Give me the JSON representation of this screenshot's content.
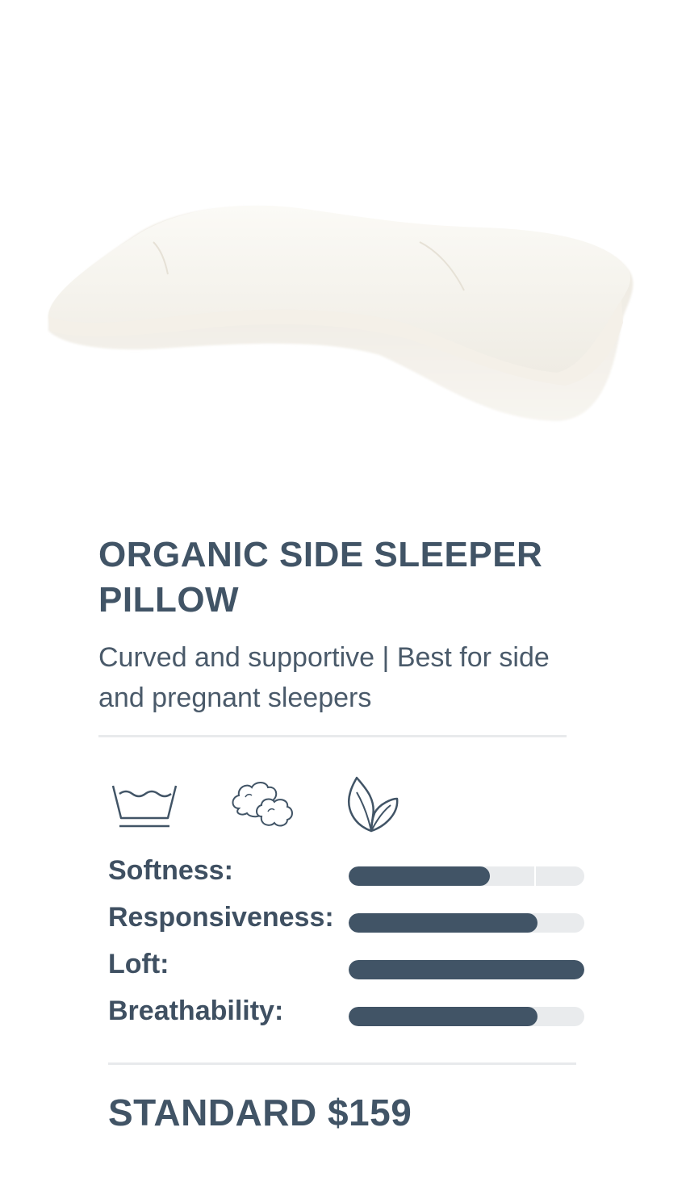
{
  "product": {
    "title": "ORGANIC SIDE SLEEPER PILLOW",
    "subtitle": "Curved and supportive | Best for side and pregnant sleepers",
    "price_label": "STANDARD $159"
  },
  "feature_icons": [
    {
      "icon": "washable-icon"
    },
    {
      "icon": "cotton-fill-icon"
    },
    {
      "icon": "organic-leaf-icon"
    }
  ],
  "ratings": [
    {
      "label": "Softness:",
      "value": 0.6
    },
    {
      "label": "Responsiveness:",
      "value": 0.8
    },
    {
      "label": "Loft:",
      "value": 1.0
    },
    {
      "label": "Breathability:",
      "value": 0.8
    }
  ],
  "colors": {
    "text": "#415466",
    "bar_fill": "#415466",
    "bar_track": "#e9ebed"
  }
}
